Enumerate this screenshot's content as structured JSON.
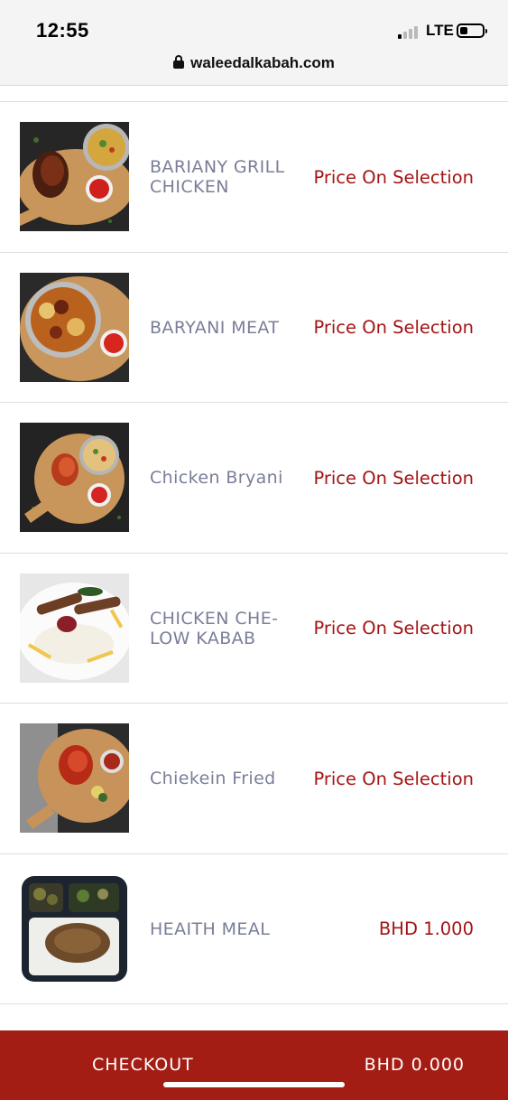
{
  "status_bar": {
    "time": "12:55",
    "network": "LTE"
  },
  "url_bar": {
    "domain": "waleedalkabah.com"
  },
  "menu": {
    "items": [
      {
        "name": "BARIANY GRILL CHICKEN",
        "price": "Price On Selection",
        "image": "grill-chicken-plate"
      },
      {
        "name": "BARYANI MEAT",
        "price": "Price On Selection",
        "image": "meat-biryani-bowl"
      },
      {
        "name": "Chicken Bryani",
        "price": "Price On Selection",
        "image": "chicken-biryani-plate"
      },
      {
        "name": "CHICKEN CHE-LOW KABAB",
        "price": "Price On Selection",
        "image": "chelow-kabab-plate"
      },
      {
        "name": "Chiekein Fried",
        "price": "Price On Selection",
        "image": "fried-chicken-board"
      },
      {
        "name": "HEAITH MEAL",
        "price": "BHD 1.000",
        "image": "health-meal-box"
      }
    ]
  },
  "checkout": {
    "label": "CHECKOUT",
    "total": "BHD 0.000"
  },
  "colors": {
    "accent": "#a41d14",
    "price": "#a41414",
    "item_name": "#7a7e98"
  }
}
